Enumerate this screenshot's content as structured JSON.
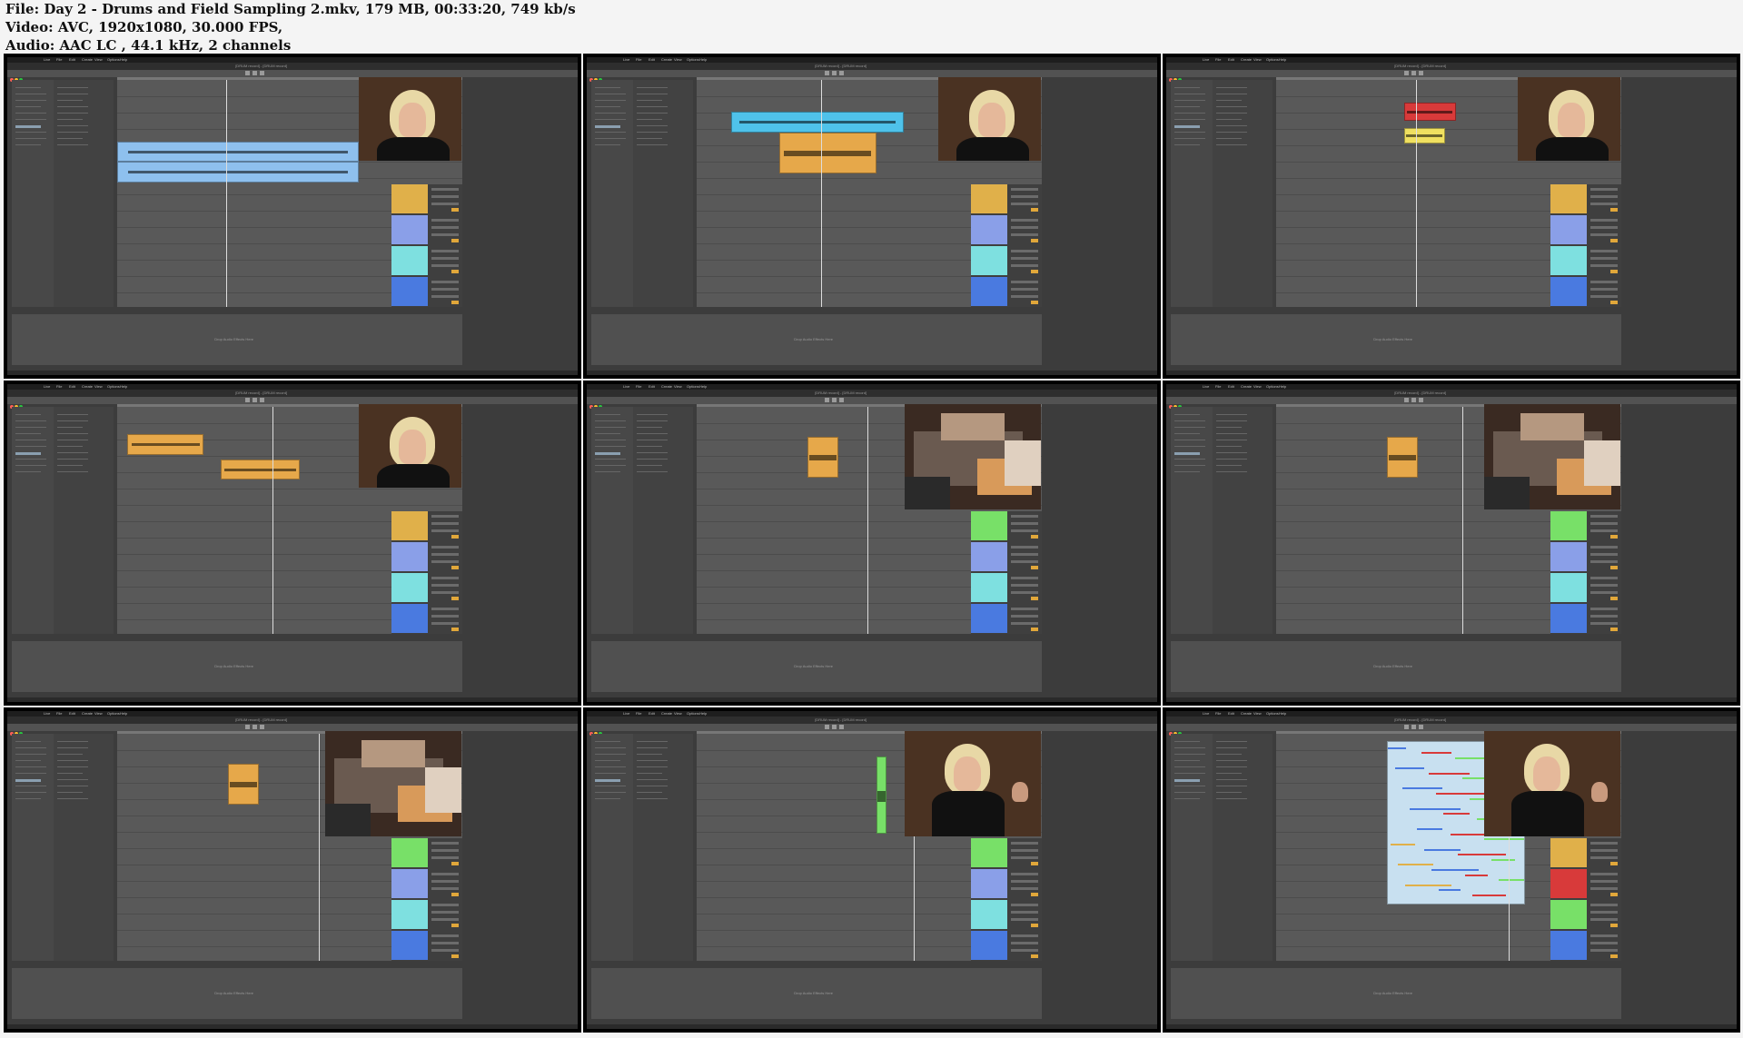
{
  "header": {
    "file_line": "File: Day 2 - Drums and Field Sampling 2.mkv, 179 MB, 00:33:20, 749 kb/s",
    "video_line": "Video: AVC, 1920x1080, 30.000 FPS,",
    "audio_line": "Audio: AAC LC , 44.1 kHz, 2 channels"
  },
  "app": {
    "menu_items": [
      "Live",
      "File",
      "Edit",
      "Create",
      "View",
      "Options",
      "Help"
    ],
    "window_title": "[DRUM record] - [DRUM record]",
    "browser_hint": "Drop Files and Devices Here",
    "detail_hint": "Drop Audio Effects Here"
  },
  "thumbnails": [
    {
      "id": "t1",
      "cam": "person-right",
      "clips": [
        {
          "color": "#8ec0ee",
          "kind": "long"
        },
        {
          "color": "#8ec0ee",
          "kind": "long2"
        }
      ],
      "mixer": [
        "#e0b04a",
        "#8a9fe8",
        "#7ee0e0",
        "#4a7ae0"
      ]
    },
    {
      "id": "t2",
      "cam": "person-right",
      "clips": [
        {
          "color": "#4fc2ea",
          "kind": "multi"
        },
        {
          "color": "#e6a84a",
          "kind": "multi2"
        }
      ],
      "mixer": [
        "#e0b04a",
        "#8a9fe8",
        "#7ee0e0",
        "#4a7ae0"
      ]
    },
    {
      "id": "t3",
      "cam": "person-right",
      "clips": [
        {
          "color": "#d83a3a",
          "kind": "short"
        },
        {
          "color": "#f0e060",
          "kind": "short2"
        }
      ],
      "mixer": [
        "#e0b04a",
        "#8a9fe8",
        "#7ee0e0",
        "#4a7ae0"
      ]
    },
    {
      "id": "t4",
      "cam": "person-right",
      "clips": [
        {
          "color": "#e6a84a",
          "kind": "mid"
        },
        {
          "color": "#e6a84a",
          "kind": "mid2"
        }
      ],
      "mixer": [
        "#e0b04a",
        "#8a9fe8",
        "#7ee0e0",
        "#4a7ae0"
      ]
    },
    {
      "id": "t5",
      "cam": "gear",
      "clips": [
        {
          "color": "#e6a84a",
          "kind": "tiny"
        }
      ],
      "mixer": [
        "#78e068",
        "#8a9fe8",
        "#7ee0e0",
        "#4a7ae0"
      ]
    },
    {
      "id": "t6",
      "cam": "gear",
      "clips": [
        {
          "color": "#e6a84a",
          "kind": "tiny"
        }
      ],
      "mixer": [
        "#78e068",
        "#8a9fe8",
        "#7ee0e0",
        "#4a7ae0"
      ]
    },
    {
      "id": "t7",
      "cam": "gear",
      "clips": [
        {
          "color": "#e6a84a",
          "kind": "tiny"
        }
      ],
      "mixer": [
        "#78e068",
        "#8a9fe8",
        "#7ee0e0",
        "#4a7ae0"
      ]
    },
    {
      "id": "t8",
      "cam": "person-two",
      "clips": [
        {
          "color": "#78e068",
          "kind": "strip"
        }
      ],
      "mixer": [
        "#78e068",
        "#8a9fe8",
        "#7ee0e0",
        "#4a7ae0"
      ]
    },
    {
      "id": "t9",
      "cam": "person-two",
      "clips": [
        {
          "color": "#c8e0f0",
          "kind": "dense"
        }
      ],
      "mixer": [
        "#e0b04a",
        "#d83a3a",
        "#78e068",
        "#4a7ae0"
      ]
    }
  ]
}
